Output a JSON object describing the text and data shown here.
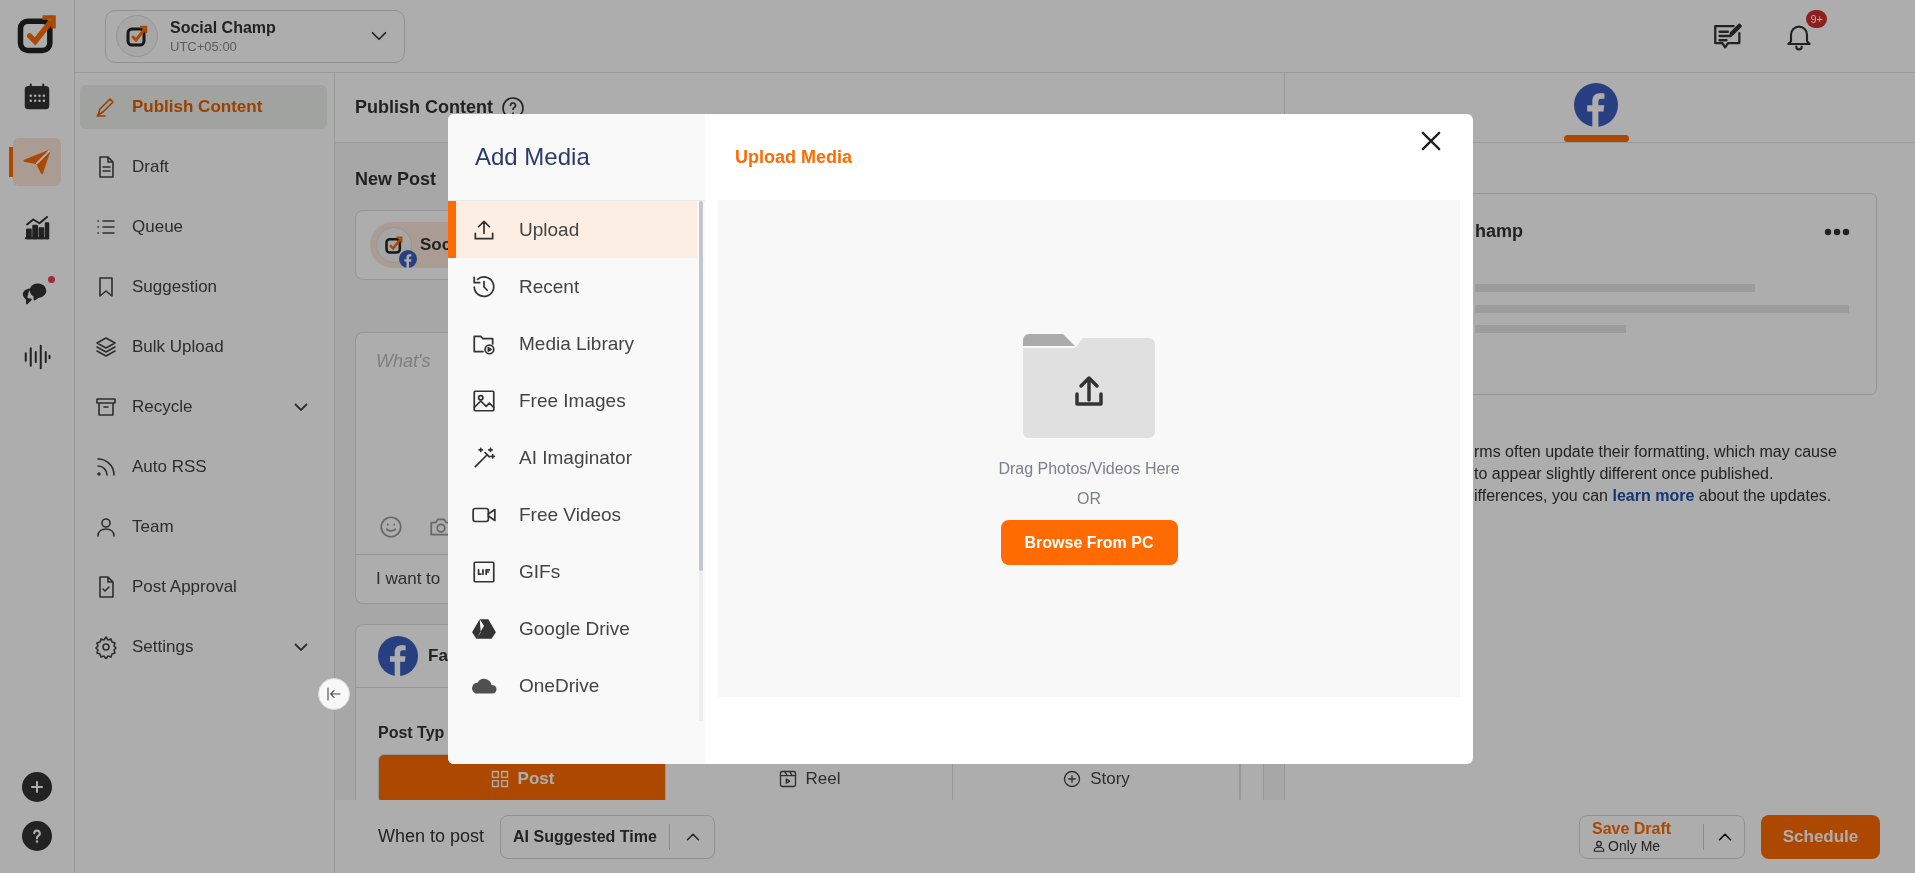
{
  "rail": {
    "items": [
      {
        "selected": false,
        "dot": false
      },
      {
        "selected": true,
        "dot": false
      },
      {
        "selected": false,
        "dot": false
      },
      {
        "selected": false,
        "dot": true
      },
      {
        "selected": false,
        "dot": false
      }
    ]
  },
  "account": {
    "name": "Social Champ",
    "timezone": "UTC+05:00"
  },
  "notifications_badge": "9+",
  "sidebar": {
    "items": [
      {
        "label": "Publish Content",
        "selected": true,
        "submenu": false
      },
      {
        "label": "Draft",
        "selected": false,
        "submenu": false
      },
      {
        "label": "Queue",
        "selected": false,
        "submenu": false
      },
      {
        "label": "Suggestion",
        "selected": false,
        "submenu": false
      },
      {
        "label": "Bulk Upload",
        "selected": false,
        "submenu": false
      },
      {
        "label": "Recycle",
        "selected": false,
        "submenu": true
      },
      {
        "label": "Auto RSS",
        "selected": false,
        "submenu": false
      },
      {
        "label": "Team",
        "selected": false,
        "submenu": false
      },
      {
        "label": "Post Approval",
        "selected": false,
        "submenu": false
      },
      {
        "label": "Settings",
        "selected": false,
        "submenu": true
      }
    ]
  },
  "content": {
    "title": "Publish Content",
    "section": "New Post",
    "account_chip": "Soc",
    "composer_placeholder": "What's",
    "suggestion": "I want to",
    "network_card": "Fa",
    "post_type_label": "Post Typ",
    "post_types": [
      {
        "label": "Post",
        "selected": true
      },
      {
        "label": "Reel",
        "selected": false
      },
      {
        "label": "Story",
        "selected": false
      }
    ]
  },
  "preview": {
    "account_name": "hamp",
    "notice_lines": [
      "rms often update their formatting, which may cause",
      "to appear slightly different once published."
    ],
    "notice_last_start": "ifferences, you can",
    "notice_link": "learn more",
    "notice_last_end": "about the updates."
  },
  "footer": {
    "when_label": "When to post",
    "when_value": "AI Suggested Time",
    "save_draft": "Save Draft",
    "visibility": "Only Me",
    "schedule": "Schedule"
  },
  "modal": {
    "title": "Add Media",
    "menu": [
      {
        "label": "Upload",
        "selected": true
      },
      {
        "label": "Recent",
        "selected": false
      },
      {
        "label": "Media Library",
        "selected": false
      },
      {
        "label": "Free Images",
        "selected": false
      },
      {
        "label": "AI Imaginator",
        "selected": false
      },
      {
        "label": "Free Videos",
        "selected": false
      },
      {
        "label": "GIFs",
        "selected": false
      },
      {
        "label": "Google Drive",
        "selected": false
      },
      {
        "label": "OneDrive",
        "selected": false
      }
    ],
    "panel_title": "Upload Media",
    "drop_hint": "Drag Photos/Videos Here",
    "or": "OR",
    "browse": "Browse From PC"
  }
}
